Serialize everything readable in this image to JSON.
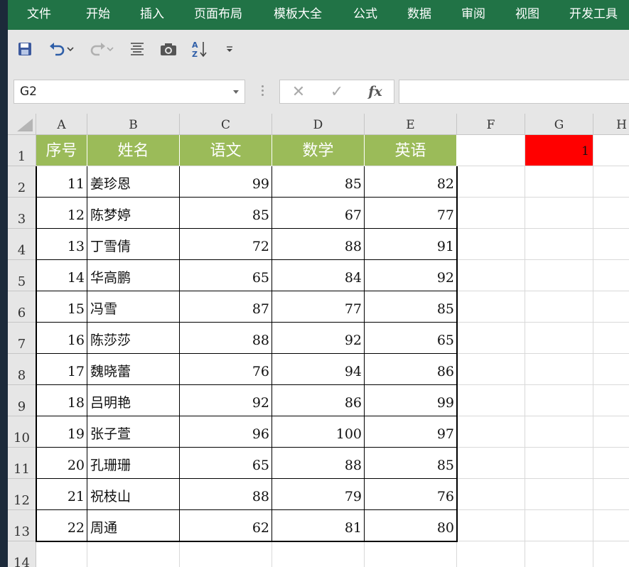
{
  "menu": [
    "文件",
    "开始",
    "插入",
    "页面布局",
    "模板大全",
    "公式",
    "数据",
    "审阅",
    "视图",
    "开发工具"
  ],
  "quick_access": {
    "icons": [
      "save-icon",
      "undo-icon",
      "redo-icon",
      "align-icon",
      "camera-icon",
      "sort-az-icon",
      "customize-icon"
    ],
    "sort_letters": "A Z"
  },
  "formula_bar": {
    "name_box": "G2",
    "cancel_symbol": "✕",
    "enter_symbol": "✓",
    "fx_label": "fx",
    "value": ""
  },
  "sheet": {
    "columns": [
      "A",
      "B",
      "C",
      "D",
      "E",
      "F",
      "G",
      "H"
    ],
    "row_numbers": [
      "1",
      "2",
      "3",
      "4",
      "5",
      "6",
      "7",
      "8",
      "9",
      "10",
      "11",
      "12",
      "13",
      "14"
    ],
    "header_row": [
      "序号",
      "姓名",
      "语文",
      "数学",
      "英语"
    ],
    "rows": [
      [
        "11",
        "姜珍恩",
        "99",
        "85",
        "82"
      ],
      [
        "12",
        "陈梦婷",
        "85",
        "67",
        "77"
      ],
      [
        "13",
        "丁雪倩",
        "72",
        "88",
        "91"
      ],
      [
        "14",
        "华高鹏",
        "65",
        "84",
        "92"
      ],
      [
        "15",
        "冯雪",
        "87",
        "77",
        "85"
      ],
      [
        "16",
        "陈莎莎",
        "88",
        "92",
        "65"
      ],
      [
        "17",
        "魏晓蕾",
        "76",
        "94",
        "86"
      ],
      [
        "18",
        "吕明艳",
        "92",
        "86",
        "99"
      ],
      [
        "19",
        "张子萱",
        "96",
        "100",
        "97"
      ],
      [
        "20",
        "孔珊珊",
        "65",
        "88",
        "85"
      ],
      [
        "21",
        "祝枝山",
        "88",
        "79",
        "76"
      ],
      [
        "22",
        "周通",
        "62",
        "81",
        "80"
      ]
    ],
    "g1_value": "1",
    "colors": {
      "header_fill": "#9bbb59",
      "header_text": "#ffffff",
      "g1_fill": "#ff0000",
      "ribbon": "#217346"
    }
  }
}
